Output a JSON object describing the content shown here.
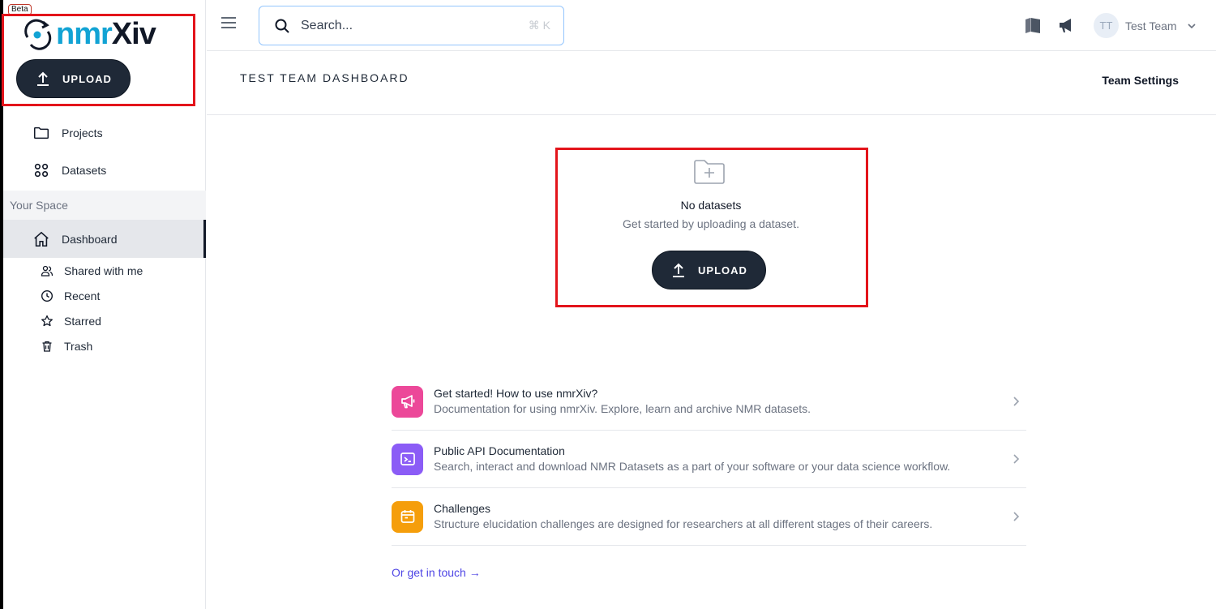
{
  "app": {
    "badge": "Beta",
    "logo_part1": "nmr",
    "logo_part2": "Xiv",
    "upload_label": "UPLOAD"
  },
  "sidebar": {
    "main_items": [
      {
        "label": "Projects",
        "icon": "folder-icon"
      },
      {
        "label": "Datasets",
        "icon": "grid-icon"
      }
    ],
    "section_label": "Your Space",
    "dashboard_label": "Dashboard",
    "sub_items": [
      {
        "label": "Shared with me",
        "icon": "users-icon"
      },
      {
        "label": "Recent",
        "icon": "clock-icon"
      },
      {
        "label": "Starred",
        "icon": "star-icon"
      },
      {
        "label": "Trash",
        "icon": "trash-icon"
      }
    ]
  },
  "topbar": {
    "search_placeholder": "Search...",
    "search_shortcut": "⌘ K",
    "user_initials": "TT",
    "user_name": "Test Team"
  },
  "header": {
    "title": "TEST TEAM DASHBOARD",
    "settings_label": "Team Settings"
  },
  "empty_state": {
    "title": "No datasets",
    "subtitle": "Get started by uploading a dataset.",
    "button_label": "UPLOAD"
  },
  "resources": [
    {
      "title": "Get started! How to use nmrXiv?",
      "description": "Documentation for using nmrXiv. Explore, learn and archive NMR datasets.",
      "color": "#ec4899",
      "icon": "megaphone-icon"
    },
    {
      "title": "Public API Documentation",
      "description": "Search, interact and download NMR Datasets as a part of your software or your data science workflow.",
      "color": "#8b5cf6",
      "icon": "terminal-icon"
    },
    {
      "title": "Challenges",
      "description": "Structure elucidation challenges are designed for researchers at all different stages of their careers.",
      "color": "#f59e0b",
      "icon": "calendar-icon"
    }
  ],
  "contact_label": "Or get in touch →"
}
